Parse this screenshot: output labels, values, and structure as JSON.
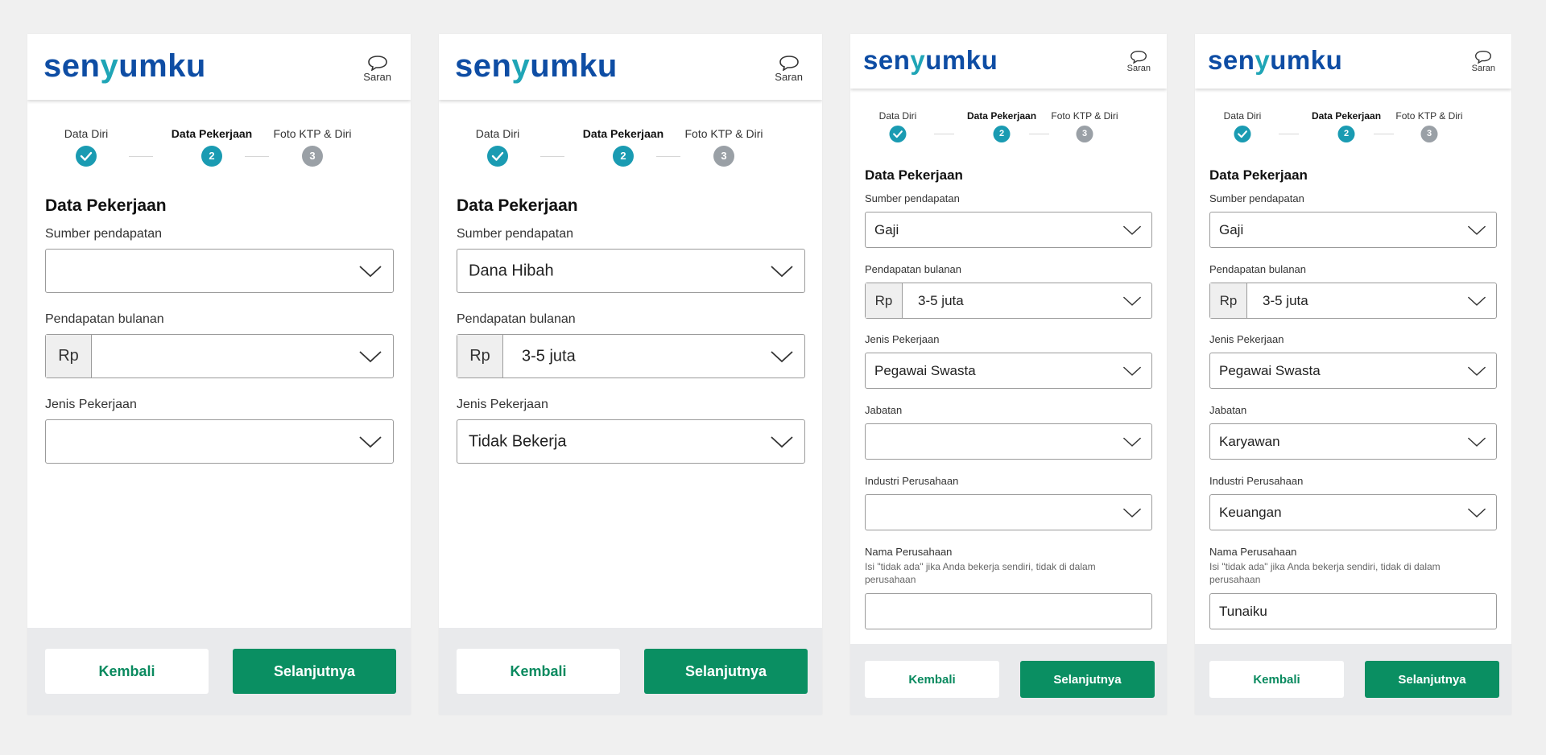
{
  "app": {
    "logo_left": "sen",
    "logo_y": "y",
    "logo_right": "umku",
    "saran_label": "Saran"
  },
  "steps": [
    "Data Diri",
    "Data Pekerjaan",
    "Foto KTP & Diri"
  ],
  "step_numbers": [
    "2",
    "3"
  ],
  "section_title": "Data Pekerjaan",
  "labels": {
    "sumber": "Sumber pendapatan",
    "pendapatan": "Pendapatan bulanan",
    "jenis": "Jenis Pekerjaan",
    "jabatan": "Jabatan",
    "industri": "Industri Perusahaan",
    "nama": "Nama Perusahaan",
    "nama_hint": "Isi \"tidak ada\" jika Anda bekerja sendiri, tidak di dalam perusahaan",
    "rp": "Rp"
  },
  "buttons": {
    "back": "Kembali",
    "next": "Selanjutnya"
  },
  "screens": [
    {
      "sumber": "",
      "pendapatan": "",
      "jenis": ""
    },
    {
      "sumber": "Dana Hibah",
      "pendapatan": "3-5 juta",
      "jenis": "Tidak Bekerja"
    },
    {
      "sumber": "Gaji",
      "pendapatan": "3-5 juta",
      "jenis": "Pegawai Swasta",
      "jabatan": "",
      "industri": "",
      "nama": ""
    },
    {
      "sumber": "Gaji",
      "pendapatan": "3-5 juta",
      "jenis": "Pegawai Swasta",
      "jabatan": "Karyawan",
      "industri": "Keuangan",
      "nama": "Tunaiku"
    }
  ],
  "colors": {
    "brand_blue": "#0e4da4",
    "teal": "#1a9bb2",
    "green": "#0a8f62",
    "gray_step": "#9aa0a6"
  }
}
